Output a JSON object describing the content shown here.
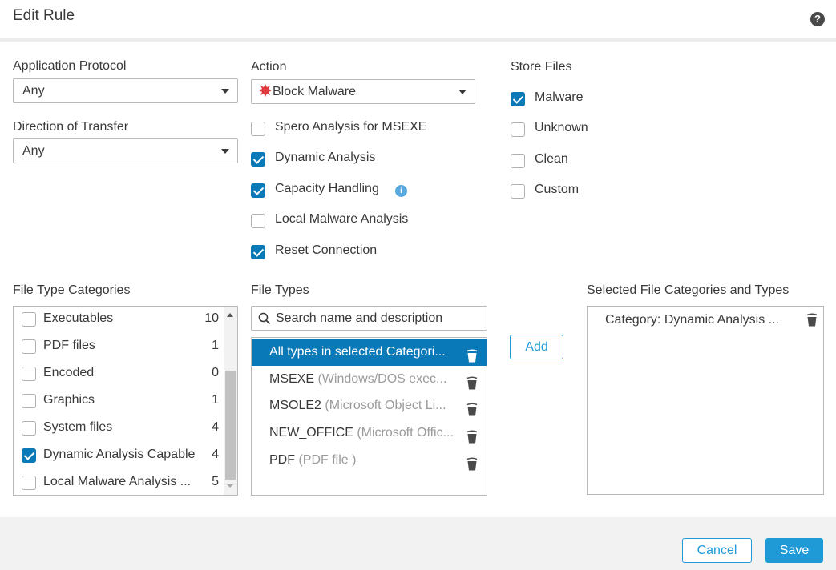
{
  "dialog": {
    "title": "Edit Rule",
    "help_icon": "question-circle-icon"
  },
  "application_protocol": {
    "label": "Application Protocol",
    "value": "Any"
  },
  "direction_of_transfer": {
    "label": "Direction of Transfer",
    "value": "Any"
  },
  "action": {
    "label": "Action",
    "value": "Block Malware",
    "icon": "malware-icon",
    "icon_color": "#e0393e",
    "options": [
      {
        "label": "Spero Analysis for MSEXE",
        "checked": false
      },
      {
        "label": "Dynamic Analysis",
        "checked": true
      },
      {
        "label": "Capacity Handling",
        "checked": true,
        "info_icon": true
      },
      {
        "label": "Local Malware Analysis",
        "checked": false
      },
      {
        "label": "Reset Connection",
        "checked": true
      }
    ]
  },
  "store_files": {
    "label": "Store Files",
    "options": [
      {
        "label": "Malware",
        "checked": true
      },
      {
        "label": "Unknown",
        "checked": false
      },
      {
        "label": "Clean",
        "checked": false
      },
      {
        "label": "Custom",
        "checked": false
      }
    ]
  },
  "file_type_categories": {
    "label": "File Type Categories",
    "items": [
      {
        "label": "Executables",
        "count": "10",
        "checked": false
      },
      {
        "label": "PDF files",
        "count": "1",
        "checked": false
      },
      {
        "label": "Encoded",
        "count": "0",
        "checked": false
      },
      {
        "label": "Graphics",
        "count": "1",
        "checked": false
      },
      {
        "label": "System files",
        "count": "4",
        "checked": false
      },
      {
        "label": "Dynamic Analysis Capable",
        "count": "4",
        "checked": true
      },
      {
        "label": "Local Malware Analysis ...",
        "count": "5",
        "checked": false
      }
    ]
  },
  "file_types": {
    "label": "File Types",
    "search_placeholder": "Search name and description",
    "items": [
      {
        "name": "All types in selected Categori...",
        "desc": "",
        "selected": true
      },
      {
        "name": "MSEXE",
        "desc": " (Windows/DOS exec...",
        "selected": false
      },
      {
        "name": "MSOLE2",
        "desc": " (Microsoft Object Li...",
        "selected": false
      },
      {
        "name": "NEW_OFFICE",
        "desc": " (Microsoft Offic...",
        "selected": false
      },
      {
        "name": "PDF",
        "desc": " (PDF file )",
        "selected": false
      }
    ]
  },
  "add_button": "Add",
  "selected": {
    "label": "Selected File Categories and Types",
    "items": [
      "Category: Dynamic Analysis ..."
    ]
  },
  "footer": {
    "cancel": "Cancel",
    "save": "Save"
  },
  "colors": {
    "accent": "#1f9ad6",
    "checkbox_checked": "#0a79b8",
    "selected_row": "#0a79b8",
    "info_icon": "#5aa9de"
  }
}
